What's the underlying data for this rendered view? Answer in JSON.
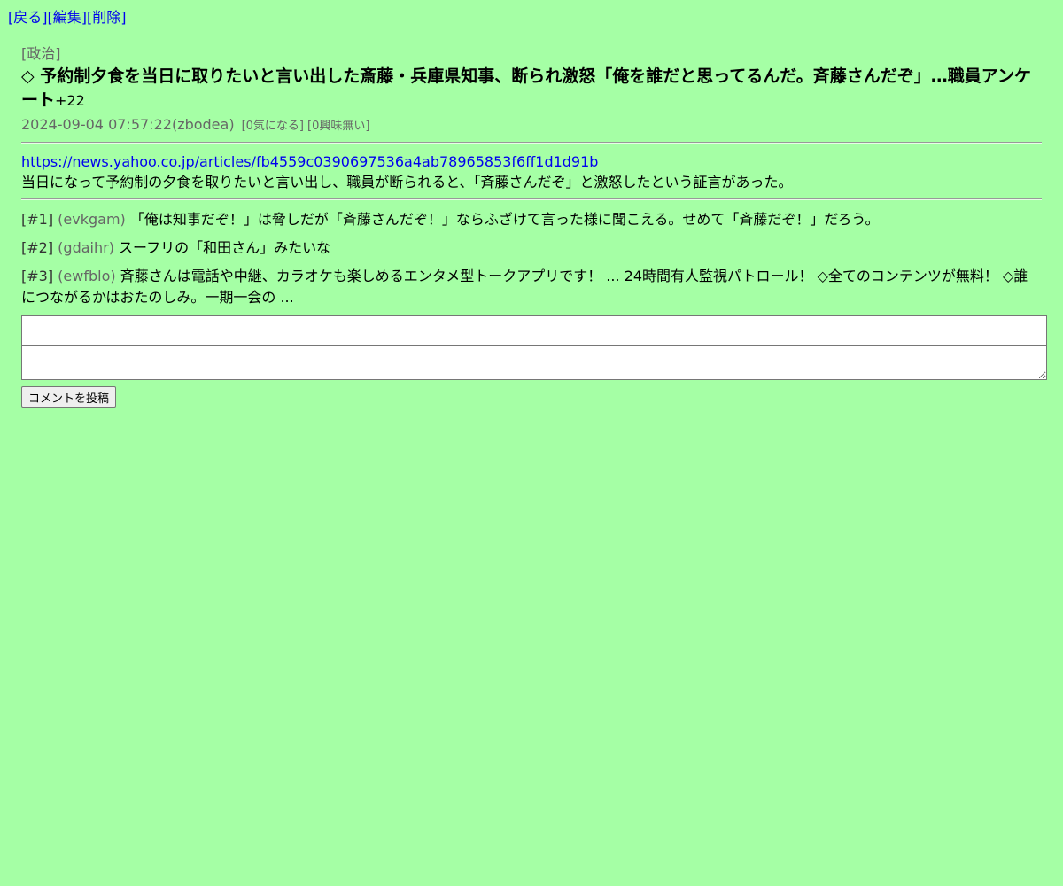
{
  "nav": {
    "back": "[戻る]",
    "edit": "[編集]",
    "delete": "[削除]"
  },
  "post": {
    "category": "[政治]",
    "title": "◇ 予約制夕食を当日に取りたいと言い出した斎藤・兵庫県知事、断られ激怒「俺を誰だと思ってるんだ。斉藤さんだぞ」…職員アンケート",
    "score": "+22",
    "datetime": "2024-09-04 07:57:22",
    "author": "(zbodea)",
    "interested": "[0気になる]",
    "not_interested": "[0興味無い]",
    "url": "https://news.yahoo.co.jp/articles/fb4559c0390697536a4ab78965853f6ff1d1d91b",
    "summary": "当日になって予約制の夕食を取りたいと言い出し、職員が断られると、「斉藤さんだぞ」と激怒したという証言があった。"
  },
  "comments": [
    {
      "id": "[#1]",
      "user": "(evkgam)",
      "text": "「俺は知事だぞ！」は脅しだが「斉藤さんだぞ！」ならふざけて言った様に聞こえる。せめて「斉藤だぞ！」だろう。"
    },
    {
      "id": "[#2]",
      "user": "(gdaihr)",
      "text": "スーフリの「和田さん」みたいな"
    },
    {
      "id": "[#3]",
      "user": "(ewfblo)",
      "text": "斉藤さんは電話や中継、カラオケも楽しめるエンタメ型トークアプリです！ ... 24時間有人監視パトロール！ ◇全てのコンテンツが無料！ ◇誰につながるかはおたのしみ。一期一会の ..."
    }
  ],
  "form": {
    "name_value": "",
    "comment_value": "",
    "submit_label": "コメントを投稿"
  }
}
